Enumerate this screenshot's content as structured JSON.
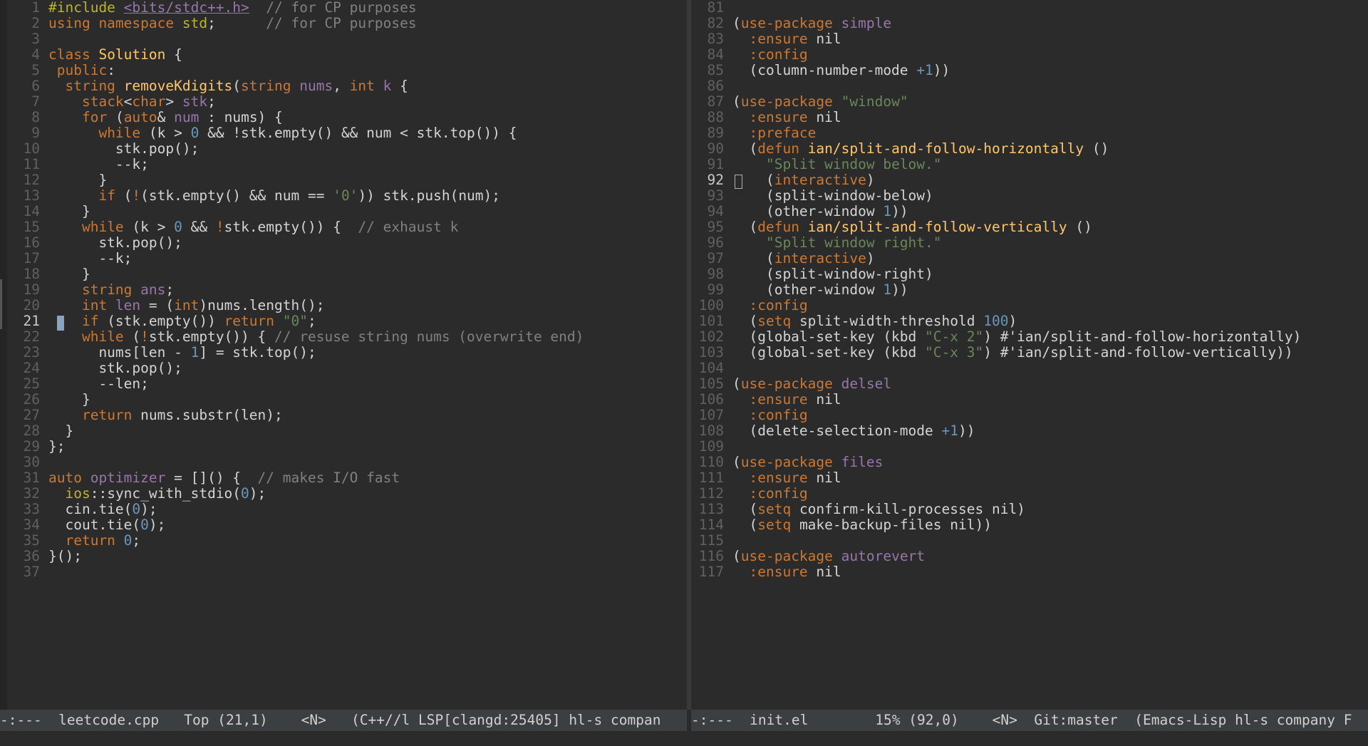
{
  "left": {
    "lines": [
      {
        "n": "1",
        "parts": [
          [
            "p",
            "#include "
          ],
          [
            "u",
            "<bits/stdc++.h>"
          ],
          [
            "c",
            "  // for CP purposes"
          ]
        ]
      },
      {
        "n": "2",
        "parts": [
          [
            "k",
            "using namespace "
          ],
          [
            "p",
            "std"
          ],
          [
            "",
            ";      "
          ],
          [
            "c",
            "// for CP purposes"
          ]
        ]
      },
      {
        "n": "3",
        "parts": []
      },
      {
        "n": "4",
        "parts": [
          [
            "k",
            "class "
          ],
          [
            "f",
            "Solution"
          ],
          [
            "",
            " {"
          ]
        ]
      },
      {
        "n": "5",
        "parts": [
          [
            "",
            " "
          ],
          [
            "k",
            "public"
          ],
          [
            "",
            ":"
          ]
        ]
      },
      {
        "n": "6",
        "parts": [
          [
            "",
            "  "
          ],
          [
            "t",
            "string "
          ],
          [
            "f",
            "removeKdigits"
          ],
          [
            "",
            "("
          ],
          [
            "t",
            "string "
          ],
          [
            "v",
            "nums"
          ],
          [
            "",
            ", "
          ],
          [
            "t",
            "int "
          ],
          [
            "v",
            "k"
          ],
          [
            "",
            " {"
          ]
        ]
      },
      {
        "n": "7",
        "parts": [
          [
            "",
            "    "
          ],
          [
            "t",
            "stack"
          ],
          [
            "",
            "<"
          ],
          [
            "t",
            "char"
          ],
          [
            "",
            "> "
          ],
          [
            "v",
            "stk"
          ],
          [
            "",
            ";"
          ]
        ]
      },
      {
        "n": "8",
        "parts": [
          [
            "",
            "    "
          ],
          [
            "k",
            "for"
          ],
          [
            "",
            " ("
          ],
          [
            "t",
            "auto"
          ],
          [
            "",
            "& "
          ],
          [
            "v",
            "num"
          ],
          [
            "",
            " : nums) {"
          ]
        ]
      },
      {
        "n": "9",
        "parts": [
          [
            "",
            "      "
          ],
          [
            "k",
            "while"
          ],
          [
            "",
            " (k > "
          ],
          [
            "n",
            "0"
          ],
          [
            "",
            " && !stk.empty() && num < stk.top()) {"
          ]
        ]
      },
      {
        "n": "10",
        "parts": [
          [
            "",
            "        stk.pop();"
          ]
        ]
      },
      {
        "n": "11",
        "parts": [
          [
            "",
            "        --k;"
          ]
        ]
      },
      {
        "n": "12",
        "parts": [
          [
            "",
            "      }"
          ]
        ]
      },
      {
        "n": "13",
        "parts": [
          [
            "",
            "      "
          ],
          [
            "k",
            "if"
          ],
          [
            "",
            " ("
          ],
          [
            "k",
            "!"
          ],
          [
            "",
            "(stk.empty() && num == "
          ],
          [
            "s",
            "'0'"
          ],
          [
            "",
            ")) stk.push(num);"
          ]
        ]
      },
      {
        "n": "14",
        "parts": [
          [
            "",
            "    }"
          ]
        ]
      },
      {
        "n": "15",
        "parts": [
          [
            "",
            "    "
          ],
          [
            "k",
            "while"
          ],
          [
            "",
            " (k > "
          ],
          [
            "n",
            "0"
          ],
          [
            "",
            " && "
          ],
          [
            "k",
            "!"
          ],
          [
            "",
            "stk.empty()) {  "
          ],
          [
            "c",
            "// exhaust k"
          ]
        ]
      },
      {
        "n": "16",
        "parts": [
          [
            "",
            "      stk.pop();"
          ]
        ]
      },
      {
        "n": "17",
        "parts": [
          [
            "",
            "      --k;"
          ]
        ]
      },
      {
        "n": "18",
        "parts": [
          [
            "",
            "    }"
          ]
        ]
      },
      {
        "n": "19",
        "parts": [
          [
            "",
            "    "
          ],
          [
            "t",
            "string "
          ],
          [
            "v",
            "ans"
          ],
          [
            "",
            ";"
          ]
        ]
      },
      {
        "n": "20",
        "parts": [
          [
            "",
            "    "
          ],
          [
            "t",
            "int "
          ],
          [
            "v",
            "len"
          ],
          [
            "",
            " = ("
          ],
          [
            "t",
            "int"
          ],
          [
            "",
            ")nums.length();"
          ]
        ]
      },
      {
        "n": "21",
        "cur": true,
        "parts": [
          [
            "",
            "    "
          ],
          [
            "k",
            "if"
          ],
          [
            "",
            " (stk.empty()) "
          ],
          [
            "k",
            "return "
          ],
          [
            "s",
            "\"0\""
          ],
          [
            "",
            ";"
          ]
        ]
      },
      {
        "n": "22",
        "parts": [
          [
            "",
            "    "
          ],
          [
            "k",
            "while"
          ],
          [
            "",
            " ("
          ],
          [
            "k",
            "!"
          ],
          [
            "",
            "stk.empty()) { "
          ],
          [
            "c",
            "// resuse string nums (overwrite end)"
          ]
        ]
      },
      {
        "n": "23",
        "parts": [
          [
            "",
            "      nums[len - "
          ],
          [
            "n",
            "1"
          ],
          [
            "",
            "] = stk.top();"
          ]
        ]
      },
      {
        "n": "24",
        "parts": [
          [
            "",
            "      stk.pop();"
          ]
        ]
      },
      {
        "n": "25",
        "parts": [
          [
            "",
            "      --len;"
          ]
        ]
      },
      {
        "n": "26",
        "parts": [
          [
            "",
            "    }"
          ]
        ]
      },
      {
        "n": "27",
        "parts": [
          [
            "",
            "    "
          ],
          [
            "k",
            "return "
          ],
          [
            "",
            "nums.substr(len);"
          ]
        ]
      },
      {
        "n": "28",
        "parts": [
          [
            "",
            "  }"
          ]
        ]
      },
      {
        "n": "29",
        "parts": [
          [
            "",
            "};"
          ]
        ]
      },
      {
        "n": "30",
        "parts": []
      },
      {
        "n": "31",
        "parts": [
          [
            "t",
            "auto "
          ],
          [
            "v",
            "optimizer"
          ],
          [
            "",
            " = []() {  "
          ],
          [
            "c",
            "// makes I/O fast"
          ]
        ]
      },
      {
        "n": "32",
        "parts": [
          [
            "",
            "  "
          ],
          [
            "p",
            "ios"
          ],
          [
            "",
            "::sync_with_stdio("
          ],
          [
            "n",
            "0"
          ],
          [
            "",
            ");"
          ]
        ]
      },
      {
        "n": "33",
        "parts": [
          [
            "",
            "  cin.tie("
          ],
          [
            "n",
            "0"
          ],
          [
            "",
            ");"
          ]
        ]
      },
      {
        "n": "34",
        "parts": [
          [
            "",
            "  cout.tie("
          ],
          [
            "n",
            "0"
          ],
          [
            "",
            ");"
          ]
        ]
      },
      {
        "n": "35",
        "parts": [
          [
            "",
            "  "
          ],
          [
            "k",
            "return "
          ],
          [
            "n",
            "0"
          ],
          [
            "",
            ";"
          ]
        ]
      },
      {
        "n": "36",
        "parts": [
          [
            "",
            "}();"
          ]
        ]
      },
      {
        "n": "37",
        "parts": []
      }
    ],
    "modeline": "-:---  leetcode.cpp   Top (21,1)    <N>   (C++//l LSP[clangd:25405] hl-s compan"
  },
  "right": {
    "lines": [
      {
        "n": "81",
        "parts": []
      },
      {
        "n": "82",
        "parts": [
          [
            "",
            "("
          ],
          [
            "k",
            "use-package "
          ],
          [
            "v",
            "simple"
          ]
        ]
      },
      {
        "n": "83",
        "parts": [
          [
            "",
            "  "
          ],
          [
            "k",
            ":ensure"
          ],
          [
            "",
            " nil"
          ]
        ]
      },
      {
        "n": "84",
        "parts": [
          [
            "",
            "  "
          ],
          [
            "k",
            ":config"
          ]
        ]
      },
      {
        "n": "85",
        "parts": [
          [
            "",
            "  (column-number-mode "
          ],
          [
            "n",
            "+1"
          ],
          [
            "",
            "))"
          ]
        ]
      },
      {
        "n": "86",
        "parts": []
      },
      {
        "n": "87",
        "parts": [
          [
            "",
            "("
          ],
          [
            "k",
            "use-package "
          ],
          [
            "s",
            "\"window\""
          ]
        ]
      },
      {
        "n": "88",
        "parts": [
          [
            "",
            "  "
          ],
          [
            "k",
            ":ensure"
          ],
          [
            "",
            " nil"
          ]
        ]
      },
      {
        "n": "89",
        "parts": [
          [
            "",
            "  "
          ],
          [
            "k",
            ":preface"
          ]
        ]
      },
      {
        "n": "90",
        "parts": [
          [
            "",
            "  ("
          ],
          [
            "k",
            "defun "
          ],
          [
            "f",
            "ian/split-and-follow-horizontally"
          ],
          [
            "",
            " ()"
          ]
        ]
      },
      {
        "n": "91",
        "parts": [
          [
            "",
            "    "
          ],
          [
            "s",
            "\"Split window below.\""
          ]
        ]
      },
      {
        "n": "92",
        "cur": true,
        "parts": [
          [
            "",
            "    ("
          ],
          [
            "k",
            "interactive"
          ],
          [
            "",
            ")"
          ]
        ]
      },
      {
        "n": "93",
        "parts": [
          [
            "",
            "    (split-window-below)"
          ]
        ]
      },
      {
        "n": "94",
        "parts": [
          [
            "",
            "    (other-window "
          ],
          [
            "n",
            "1"
          ],
          [
            "",
            "))"
          ]
        ]
      },
      {
        "n": "95",
        "parts": [
          [
            "",
            "  ("
          ],
          [
            "k",
            "defun "
          ],
          [
            "f",
            "ian/split-and-follow-vertically"
          ],
          [
            "",
            " ()"
          ]
        ]
      },
      {
        "n": "96",
        "parts": [
          [
            "",
            "    "
          ],
          [
            "s",
            "\"Split window right.\""
          ]
        ]
      },
      {
        "n": "97",
        "parts": [
          [
            "",
            "    ("
          ],
          [
            "k",
            "interactive"
          ],
          [
            "",
            ")"
          ]
        ]
      },
      {
        "n": "98",
        "parts": [
          [
            "",
            "    (split-window-right)"
          ]
        ]
      },
      {
        "n": "99",
        "parts": [
          [
            "",
            "    (other-window "
          ],
          [
            "n",
            "1"
          ],
          [
            "",
            "))"
          ]
        ]
      },
      {
        "n": "100",
        "parts": [
          [
            "",
            "  "
          ],
          [
            "k",
            ":config"
          ]
        ]
      },
      {
        "n": "101",
        "parts": [
          [
            "",
            "  ("
          ],
          [
            "k",
            "setq"
          ],
          [
            "",
            " split-width-threshold "
          ],
          [
            "n",
            "100"
          ],
          [
            "",
            ")"
          ]
        ]
      },
      {
        "n": "102",
        "parts": [
          [
            "",
            "  (global-set-key (kbd "
          ],
          [
            "s",
            "\"C-x 2\""
          ],
          [
            "",
            ") #'ian/split-and-follow-horizontally)"
          ]
        ]
      },
      {
        "n": "103",
        "parts": [
          [
            "",
            "  (global-set-key (kbd "
          ],
          [
            "s",
            "\"C-x 3\""
          ],
          [
            "",
            ") #'ian/split-and-follow-vertically))"
          ]
        ]
      },
      {
        "n": "104",
        "parts": []
      },
      {
        "n": "105",
        "parts": [
          [
            "",
            "("
          ],
          [
            "k",
            "use-package "
          ],
          [
            "v",
            "delsel"
          ]
        ]
      },
      {
        "n": "106",
        "parts": [
          [
            "",
            "  "
          ],
          [
            "k",
            ":ensure"
          ],
          [
            "",
            " nil"
          ]
        ]
      },
      {
        "n": "107",
        "parts": [
          [
            "",
            "  "
          ],
          [
            "k",
            ":config"
          ]
        ]
      },
      {
        "n": "108",
        "parts": [
          [
            "",
            "  (delete-selection-mode "
          ],
          [
            "n",
            "+1"
          ],
          [
            "",
            "))"
          ]
        ]
      },
      {
        "n": "109",
        "parts": []
      },
      {
        "n": "110",
        "parts": [
          [
            "",
            "("
          ],
          [
            "k",
            "use-package "
          ],
          [
            "v",
            "files"
          ]
        ]
      },
      {
        "n": "111",
        "parts": [
          [
            "",
            "  "
          ],
          [
            "k",
            ":ensure"
          ],
          [
            "",
            " nil"
          ]
        ]
      },
      {
        "n": "112",
        "parts": [
          [
            "",
            "  "
          ],
          [
            "k",
            ":config"
          ]
        ]
      },
      {
        "n": "113",
        "parts": [
          [
            "",
            "  ("
          ],
          [
            "k",
            "setq"
          ],
          [
            "",
            " confirm-kill-processes nil)"
          ]
        ]
      },
      {
        "n": "114",
        "parts": [
          [
            "",
            "  ("
          ],
          [
            "k",
            "setq"
          ],
          [
            "",
            " make-backup-files nil))"
          ]
        ]
      },
      {
        "n": "115",
        "parts": []
      },
      {
        "n": "116",
        "parts": [
          [
            "",
            "("
          ],
          [
            "k",
            "use-package "
          ],
          [
            "v",
            "autorevert"
          ]
        ]
      },
      {
        "n": "117",
        "parts": [
          [
            "",
            "  "
          ],
          [
            "k",
            ":ensure"
          ],
          [
            "",
            " nil"
          ]
        ]
      }
    ],
    "modeline": "-:---  init.el        15% (92,0)    <N>  Git:master  (Emacs-Lisp hl-s company F"
  },
  "colors": {
    "background": "#2b2b2b",
    "keyword": "#cc7832",
    "variable": "#9876aa",
    "function": "#ffc66d",
    "string": "#6a8759",
    "number": "#6897bb",
    "comment": "#808080"
  }
}
